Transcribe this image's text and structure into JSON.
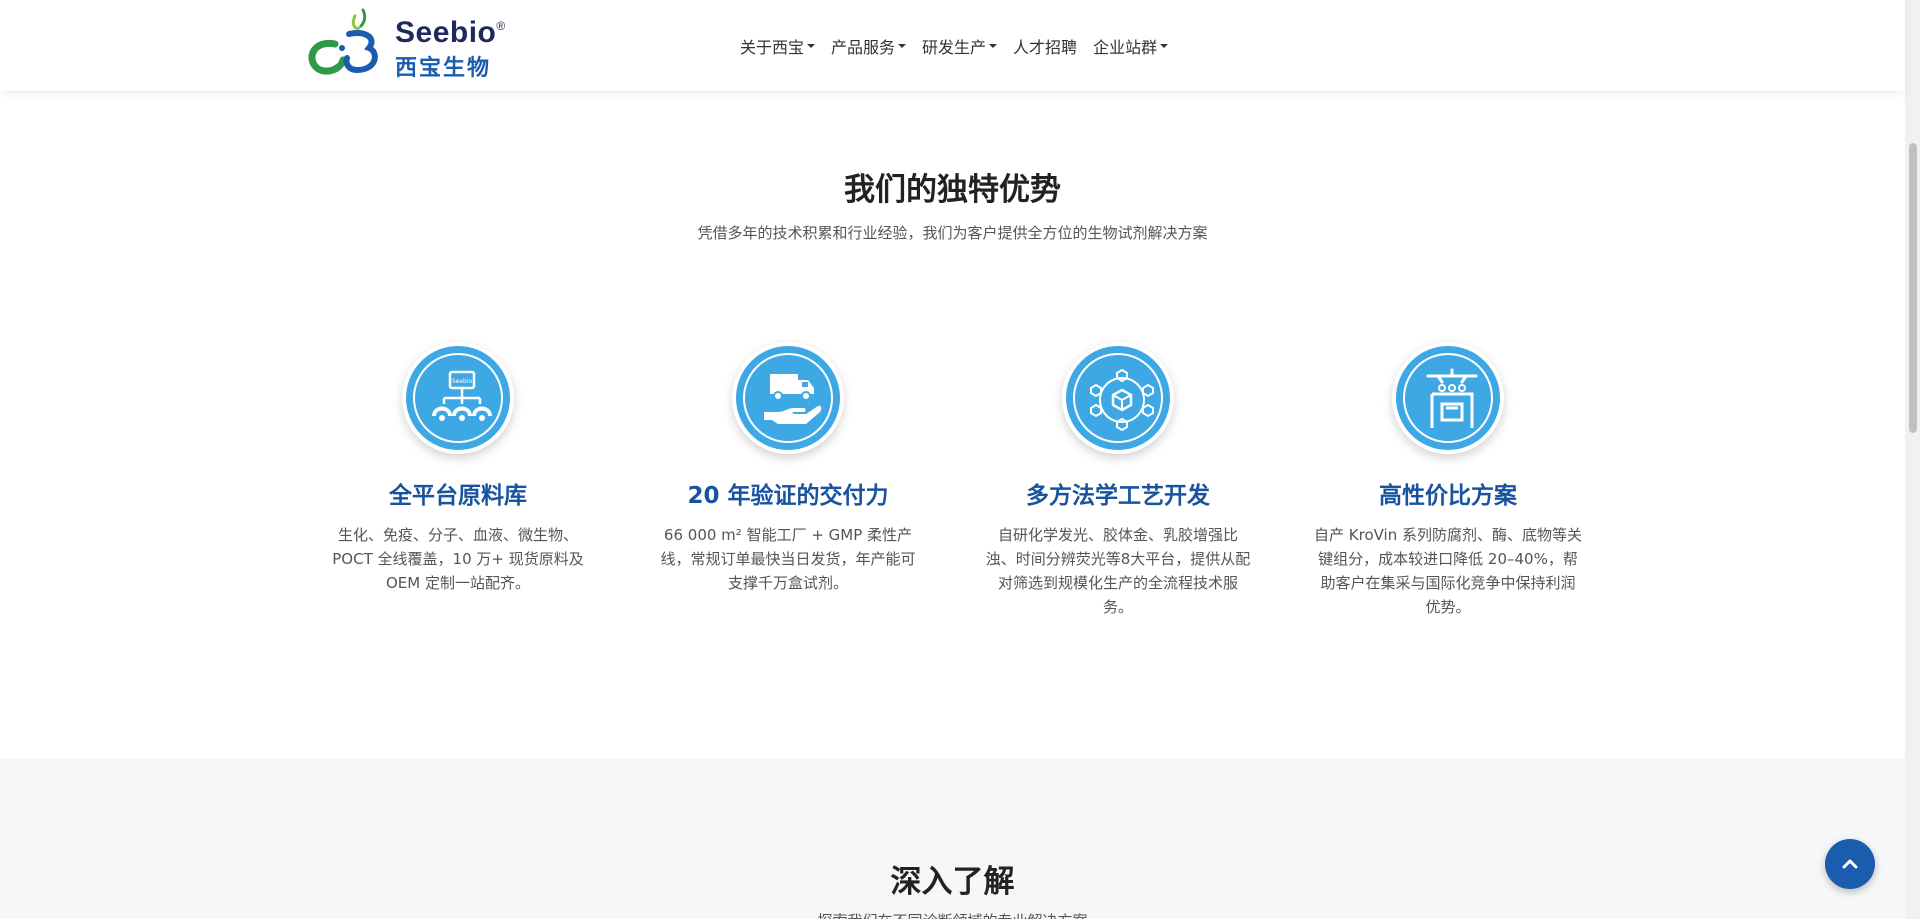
{
  "header": {
    "logo_en": "Seebio",
    "logo_reg": "®",
    "logo_cn": "西宝生物",
    "nav": [
      {
        "label": "关于西宝",
        "dropdown": true
      },
      {
        "label": "产品服务",
        "dropdown": true
      },
      {
        "label": "研发生产",
        "dropdown": true
      },
      {
        "label": "人才招聘",
        "dropdown": false
      },
      {
        "label": "企业站群",
        "dropdown": true
      }
    ]
  },
  "advantages": {
    "title": "我们的独特优势",
    "subtitle": "凭借多年的技术积累和行业经验，我们为客户提供全方位的生物试剂解决方案",
    "items": [
      {
        "icon": "raw-material-network-icon",
        "title": "全平台原料库",
        "desc": "生化、免疫、分子、血液、微生物、POCT 全线覆盖，10 万+ 现货原料及 OEM 定制一站配齐。"
      },
      {
        "icon": "delivery-truck-hand-icon",
        "title": "20 年验证的交付力",
        "desc": "66 000 m² 智能工厂 + GMP 柔性产线，常规订单最快当日发货，年产能可支撑千万盒试剂。"
      },
      {
        "icon": "hexagon-platform-icon",
        "title": "多方法学工艺开发",
        "desc": "自研化学发光、胶体金、乳胶增强比浊、时间分辨荧光等8大平台，提供从配对筛选到规模化生产的全流程技术服务。"
      },
      {
        "icon": "cost-performance-icon",
        "title": "高性价比方案",
        "desc": "自产 KroVin 系列防腐剂、酶、底物等关键组分，成本较进口降低 20–40%，帮助客户在集采与国际化竞争中保持利润优势。"
      }
    ]
  },
  "learn_more": {
    "title": "深入了解",
    "subtitle": "探索我们在不同诊断领域的专业解决方案"
  },
  "colors": {
    "brand_blue": "#17539e",
    "icon_blue": "#3ea8e5",
    "backtop": "#1a5cae"
  }
}
